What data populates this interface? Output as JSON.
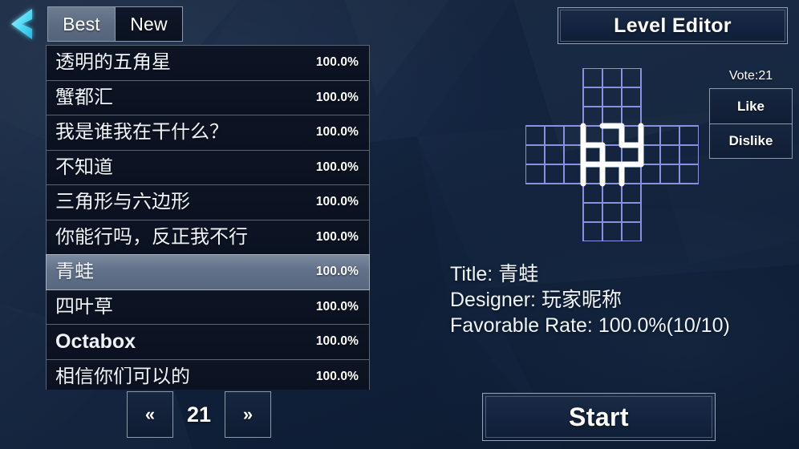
{
  "back": {
    "icon": "chevron-left-icon"
  },
  "tabs": [
    {
      "label": "Best",
      "active": true
    },
    {
      "label": "New",
      "active": false
    }
  ],
  "list": {
    "items": [
      {
        "title": "透明的五角星",
        "rate": "100.0%",
        "selected": false,
        "latin": false
      },
      {
        "title": "蟹都汇",
        "rate": "100.0%",
        "selected": false,
        "latin": false
      },
      {
        "title": "我是谁我在干什么？",
        "rate": "100.0%",
        "selected": false,
        "latin": false
      },
      {
        "title": "不知道",
        "rate": "100.0%",
        "selected": false,
        "latin": false
      },
      {
        "title": "三角形与六边形",
        "rate": "100.0%",
        "selected": false,
        "latin": false
      },
      {
        "title": "你能行吗，反正我不行",
        "rate": "100.0%",
        "selected": false,
        "latin": false
      },
      {
        "title": "青蛙",
        "rate": "100.0%",
        "selected": true,
        "latin": false
      },
      {
        "title": "四叶草",
        "rate": "100.0%",
        "selected": false,
        "latin": false
      },
      {
        "title": "Octabox",
        "rate": "100.0%",
        "selected": false,
        "latin": true
      },
      {
        "title": "相信你们可以的",
        "rate": "100.0%",
        "selected": false,
        "latin": false
      }
    ]
  },
  "pager": {
    "prev_label": "«",
    "page": "21",
    "next_label": "»"
  },
  "level_editor": {
    "label": "Level Editor"
  },
  "vote": {
    "count_label": "Vote:21",
    "like_label": "Like",
    "dislike_label": "Dislike"
  },
  "details": {
    "title_line": "Title: 青蛙",
    "designer_line": "Designer: 玩家昵称",
    "rate_line": "Favorable Rate: 100.0%(10/10)"
  },
  "start": {
    "label": "Start"
  },
  "colors": {
    "background": "#13243f",
    "grid_line": "#8b8fe0",
    "path": "#ffffff",
    "accent_arrow": "#4fd8f5",
    "selected_row": "#62718a"
  }
}
